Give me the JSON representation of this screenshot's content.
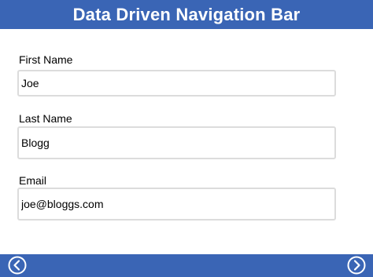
{
  "header": {
    "title": "Data Driven Navigation Bar"
  },
  "form": {
    "first_name": {
      "label": "First Name",
      "value": "Joe"
    },
    "last_name": {
      "label": "Last Name",
      "value": "Blogg"
    },
    "email": {
      "label": "Email",
      "value": "joe@bloggs.com"
    }
  },
  "nav": {
    "back_icon": "chevron-left-circle-icon",
    "forward_icon": "chevron-right-circle-icon"
  },
  "colors": {
    "accent": "#3a65b5",
    "input_border": "#dcdcdc"
  }
}
